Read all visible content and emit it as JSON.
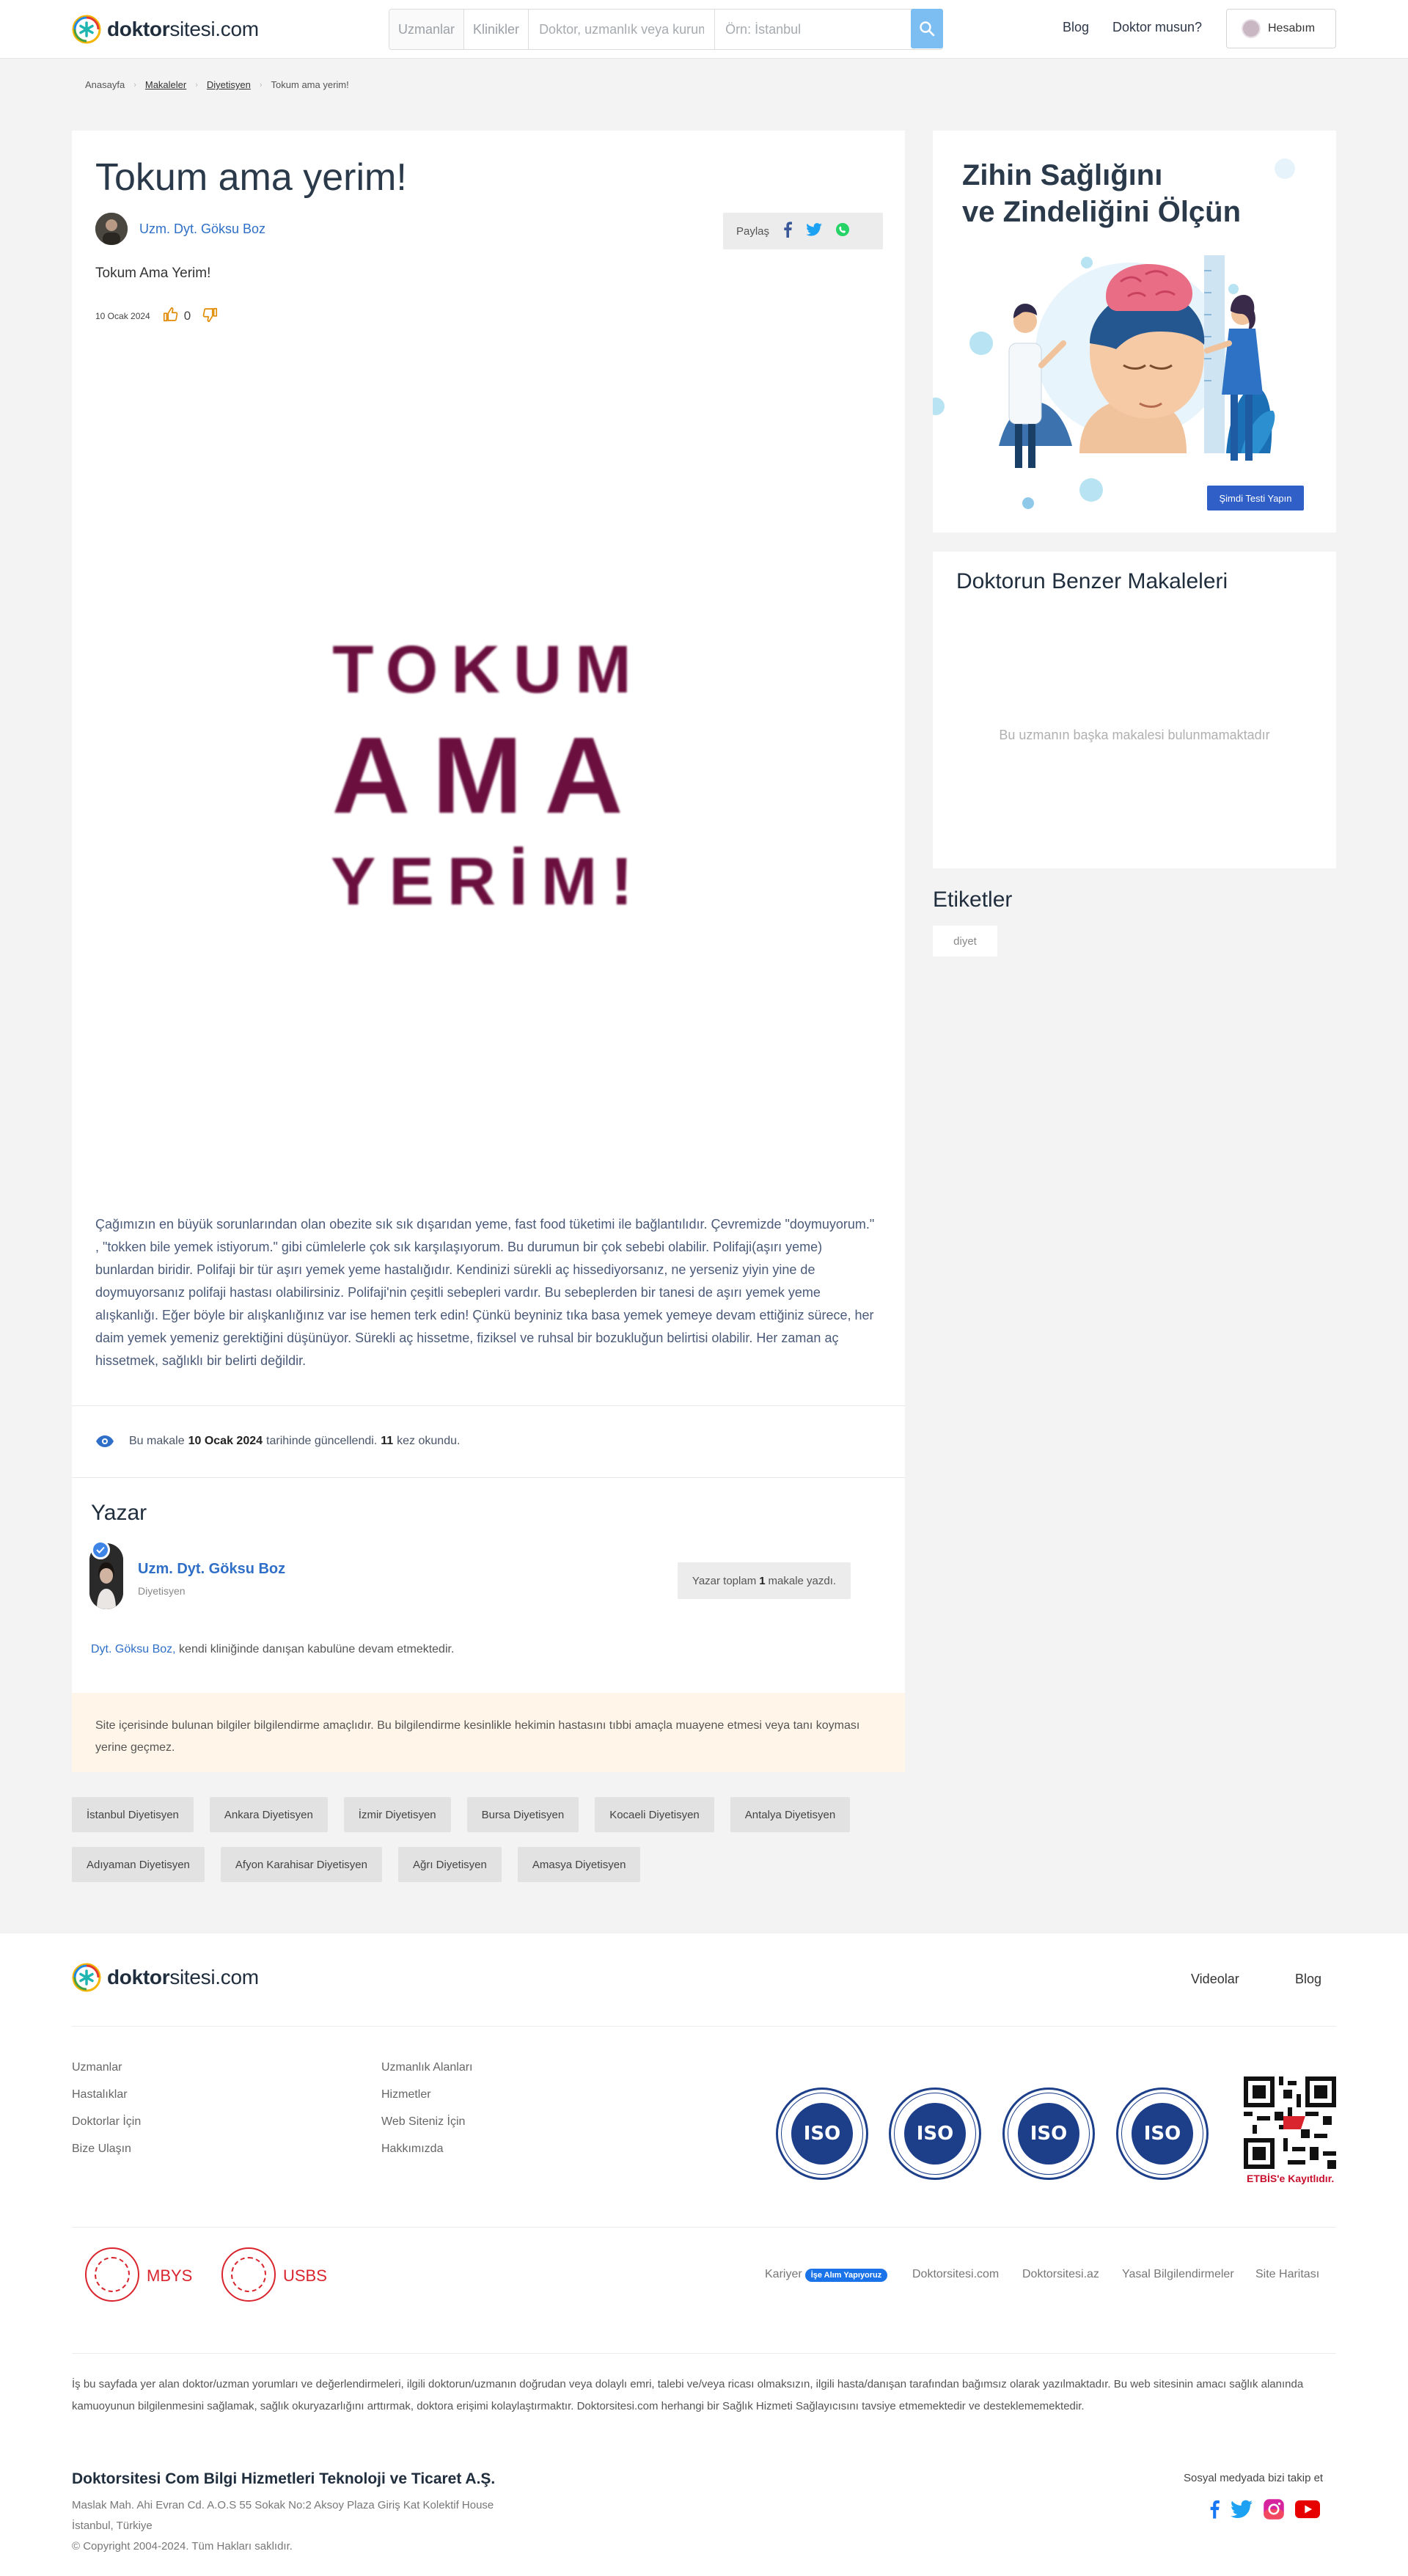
{
  "header": {
    "logo": {
      "bold": "doktor",
      "rest": "sitesi.com"
    },
    "search": {
      "tab_uzmanlar": "Uzmanlar",
      "tab_klinikler": "Klinikler",
      "query_placeholder": "Doktor, uzmanlık veya kurum",
      "location_placeholder": "Örn: İstanbul"
    },
    "nav": {
      "blog": "Blog",
      "doktor_musun": "Doktor musun?",
      "account": "Hesabım"
    }
  },
  "breadcrumb": [
    "Anasayfa",
    "Makaleler",
    "Diyetisyen",
    "Tokum ama yerim!"
  ],
  "article": {
    "title": "Tokum ama yerim!",
    "author": "Uzm. Dyt. Göksu Boz",
    "share_label": "Paylaş",
    "lead": "Tokum Ama Yerim!",
    "date": "10 Ocak 2024",
    "likes": "0",
    "hero_lines": [
      "TOKUM",
      "AMA",
      "YERİM!"
    ],
    "body": "Çağımızın en büyük sorunlarından olan obezite sık sık dışarıdan yeme, fast food tüketimi ile bağlantılıdır. Çevremizde \"doymuyorum.\" , \"tokken bile yemek istiyorum.\" gibi cümlelerle çok sık karşılaşıyorum. Bu durumun bir çok sebebi olabilir. Polifaji(aşırı yeme) bunlardan biridir. Polifaji bir tür aşırı yemek yeme hastalığıdır. Kendinizi sürekli aç hissediyorsanız, ne yerseniz yiyin yine de doymuyorsanız polifaji hastası olabilirsiniz. Polifaji'nin çeşitli sebepleri vardır. Bu sebeplerden bir tanesi de aşırı yemek yeme alışkanlığı. Eğer böyle bir alışkanlığınız var ise hemen terk edin! Çünkü beyniniz tıka basa yemek yemeye devam ettiğiniz sürece, her daim yemek yemeniz gerektiğini düşünüyor. Sürekli aç hissetme, fiziksel ve ruhsal bir bozukluğun belirtisi olabilir. Her zaman aç hissetmek, sağlıklı bir belirti değildir.",
    "views": {
      "prefix": "Bu makale",
      "date": "10 Ocak 2024",
      "mid": "tarihinde güncellendi.",
      "count": "11",
      "suffix": "kez okundu."
    }
  },
  "yazar": {
    "heading": "Yazar",
    "name": "Uzm. Dyt. Göksu Boz",
    "role": "Diyetisyen",
    "count_prefix": "Yazar toplam",
    "count": "1",
    "count_suffix": "makale yazdı.",
    "clinic_name": "Dyt. Göksu Boz,",
    "clinic_text": "kendi kliniğinde danışan kabulüne devam etmektedir."
  },
  "disclaimer": "Site içerisinde bulunan bilgiler bilgilendirme amaçlıdır. Bu bilgilendirme kesinlikle hekimin hastasını tıbbi amaçla muayene etmesi veya tanı koyması yerine geçmez.",
  "city_tags": [
    "İstanbul Diyetisyen",
    "Ankara Diyetisyen",
    "İzmir Diyetisyen",
    "Bursa Diyetisyen",
    "Kocaeli Diyetisyen",
    "Antalya Diyetisyen",
    "Adıyaman Diyetisyen",
    "Afyon Karahisar Diyetisyen",
    "Ağrı Diyetisyen",
    "Amasya Diyetisyen"
  ],
  "sidebar": {
    "ad_title_1": "Zihin Sağlığını",
    "ad_title_2": "ve Zindeliğini Ölçün",
    "ad_button": "Şimdi Testi Yapın",
    "similar_title": "Doktorun Benzer Makaleleri",
    "similar_empty": "Bu uzmanın başka makalesi bulunmamaktadır",
    "tags_title": "Etiketler",
    "tags": [
      "diyet"
    ]
  },
  "footer": {
    "nav": {
      "videolar": "Videolar",
      "blog": "Blog"
    },
    "col1": [
      "Uzmanlar",
      "Hastalıklar",
      "Doktorlar İçin",
      "Bize Ulaşın"
    ],
    "col2": [
      "Uzmanlık Alanları",
      "Hizmetler",
      "Web Siteniz İçin",
      "Hakkımızda"
    ],
    "iso_text": "ISO",
    "etbis": "ETBİS'e Kayıtlıdır.",
    "seals": [
      "MBYS",
      "USBS"
    ],
    "links": {
      "kariyer": "Kariyer",
      "badge": "İşe Alım Yapıyoruz",
      "l1": "Doktorsitesi.com",
      "l2": "Doktorsitesi.az",
      "l3": "Yasal Bilgilendirmeler",
      "l4": "Site Haritası"
    },
    "legal": "İş bu sayfada yer alan doktor/uzman yorumları ve değerlendirmeleri, ilgili doktorun/uzmanın doğrudan veya dolaylı emri, talebi ve/veya ricası olmaksızın, ilgili hasta/danışan tarafından bağımsız olarak yazılmaktadır. Bu web sitesinin amacı sağlık alanında kamuoyunun bilgilenmesini sağlamak, sağlık okuryazarlığını arttırmak, doktora erişimi kolaylaştırmaktır. Doktorsitesi.com herhangi bir Sağlık Hizmeti Sağlayıcısını tavsiye etmemektedir ve desteklememektedir.",
    "company": "Doktorsitesi Com Bilgi Hizmetleri Teknoloji ve Ticaret A.Ş.",
    "address_1": "Maslak Mah. Ahi Evran Cd. A.O.S 55 Sokak No:2 Aksoy Plaza Giriş Kat Kolektif House",
    "address_2": "İstanbul, Türkiye",
    "copyright": "© Copyright 2004-2024. Tüm Hakları saklıdır.",
    "social_title": "Sosyal medyada bizi takip et"
  },
  "colors": {
    "brand_blue": "#2f6fc7",
    "hero_text": "#6b0f3f",
    "search_btn": "#7dbef2",
    "etbis_red": "#c8102e"
  }
}
